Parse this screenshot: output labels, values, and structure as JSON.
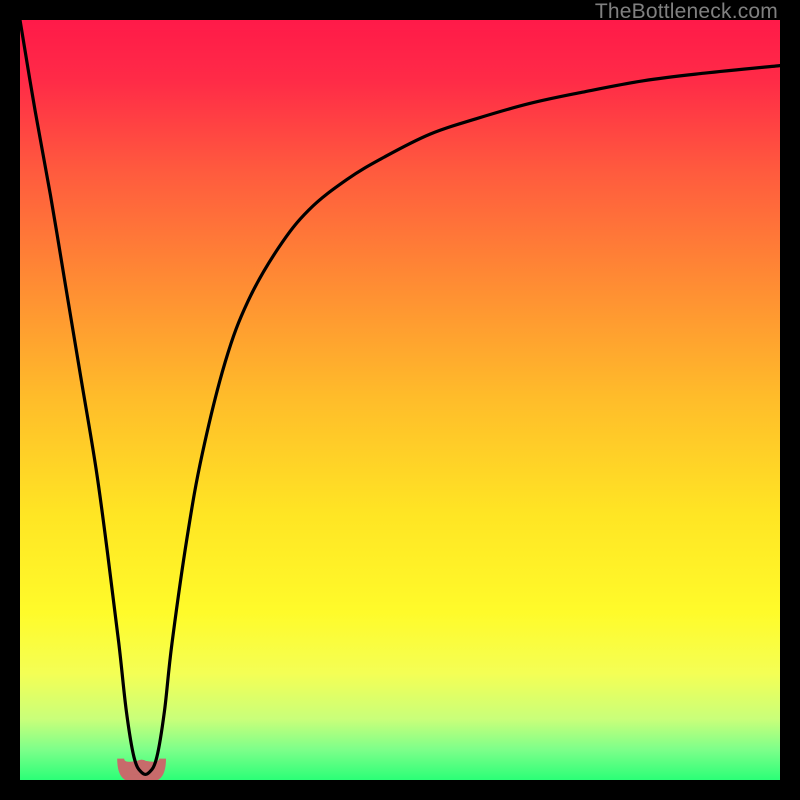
{
  "watermark": "TheBottleneck.com",
  "chart_data": {
    "type": "line",
    "title": "",
    "xlabel": "",
    "ylabel": "",
    "xlim": [
      0,
      100
    ],
    "ylim": [
      0,
      100
    ],
    "grid": false,
    "legend": false,
    "background_gradient": {
      "stops": [
        {
          "offset": 0.0,
          "color": "#ff1a49"
        },
        {
          "offset": 0.08,
          "color": "#ff2b47"
        },
        {
          "offset": 0.2,
          "color": "#ff5b3e"
        },
        {
          "offset": 0.35,
          "color": "#ff8d33"
        },
        {
          "offset": 0.5,
          "color": "#ffbd2a"
        },
        {
          "offset": 0.65,
          "color": "#ffe524"
        },
        {
          "offset": 0.78,
          "color": "#fffb2a"
        },
        {
          "offset": 0.86,
          "color": "#f4ff55"
        },
        {
          "offset": 0.92,
          "color": "#c9ff7a"
        },
        {
          "offset": 0.96,
          "color": "#7dff8a"
        },
        {
          "offset": 1.0,
          "color": "#2bff77"
        }
      ]
    },
    "series": [
      {
        "name": "bottleneck-curve",
        "color": "#000000",
        "x": [
          0,
          2,
          4,
          6,
          8,
          10,
          11.5,
          13,
          14,
          15,
          16,
          17,
          18,
          19,
          20,
          22,
          24,
          27,
          30,
          34,
          38,
          43,
          48,
          54,
          60,
          67,
          74,
          82,
          90,
          100
        ],
        "y": [
          100,
          88,
          77,
          65,
          53,
          41,
          30,
          18,
          9,
          3,
          1,
          1,
          3,
          9,
          18,
          32,
          43,
          55,
          63,
          70,
          75,
          79,
          82,
          85,
          87,
          89,
          90.5,
          92,
          93,
          94
        ]
      }
    ],
    "marker": {
      "name": "optimal-point",
      "color": "#c76b6b",
      "x": 16,
      "y": 1,
      "width_pct": 5.5
    }
  }
}
